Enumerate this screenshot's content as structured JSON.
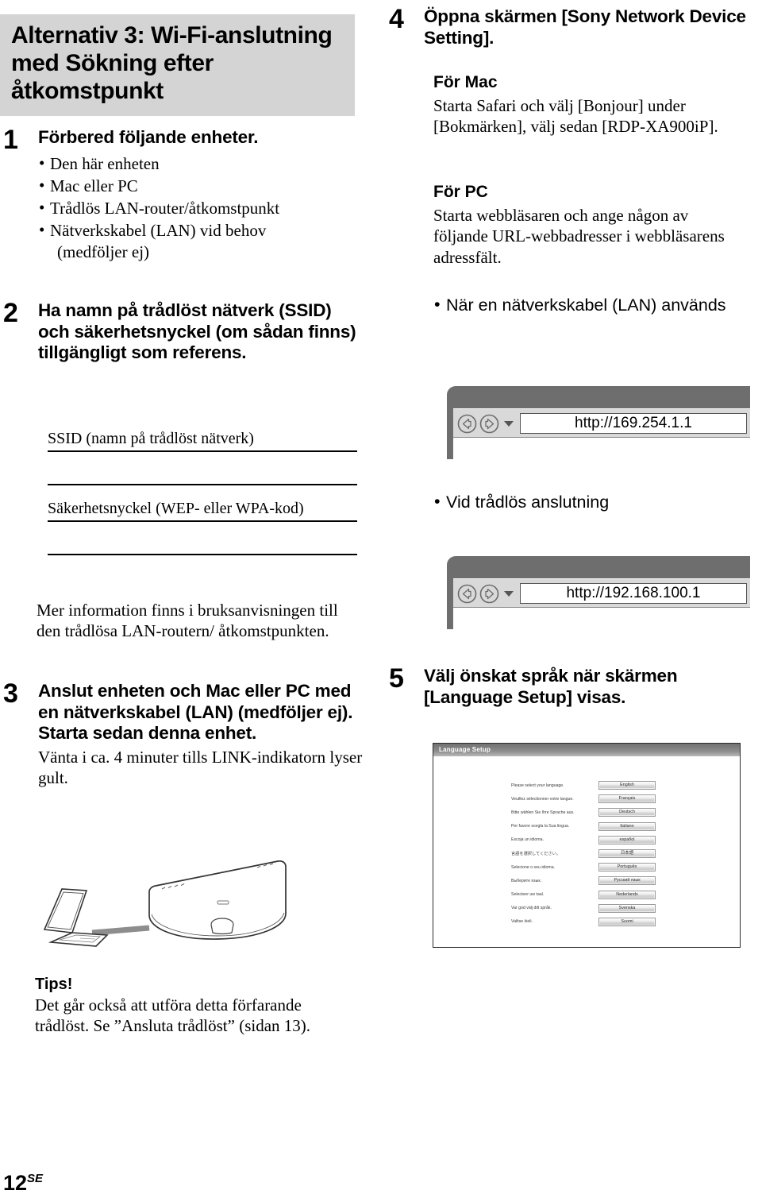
{
  "heading": {
    "text": "Alternativ 3: Wi-Fi-anslutning med Sökning efter åtkomstpunkt"
  },
  "steps": {
    "one": {
      "number": "1",
      "title": "Förbered följande enheter.",
      "bullets": [
        "Den här enheten",
        "Mac eller PC",
        "Trådlös LAN-router/åtkomstpunkt",
        "Nätverkskabel (LAN) vid behov"
      ],
      "bullet_cont": "(medföljer ej)"
    },
    "two": {
      "number": "2",
      "title": "Ha namn på trådlöst nätverk (SSID) och säkerhetsnyckel (om sådan finns) tillgängligt som referens.",
      "field_ssid_label": "SSID (namn på trådlöst nätverk)",
      "field_key_label": "Säkerhetsnyckel (WEP- eller WPA-kod)",
      "note": "Mer information finns i bruksanvisningen till den trådlösa LAN-routern/ åtkomstpunkten."
    },
    "three": {
      "number": "3",
      "title": "Anslut enheten och Mac eller PC med en nätverkskabel (LAN) (medföljer ej). Starta sedan denna enhet.",
      "note": "Vänta i ca. 4 minuter tills LINK-indikatorn lyser gult."
    },
    "four": {
      "number": "4",
      "title": "Öppna skärmen [Sony Network Device Setting].",
      "mac_head": "För Mac",
      "mac_text": "Starta Safari och välj [Bonjour] under [Bokmärken], välj sedan [RDP-XA900iP].",
      "pc_head": "För PC",
      "pc_text": "Starta webbläsaren och ange någon av följande URL-webbadresser i webbläsarens adressfält.",
      "bullet_lan": "När en nätverkskabel (LAN) används",
      "url_lan": "http://169.254.1.1",
      "bullet_wireless": "Vid trådlös anslutning",
      "url_wireless": "http://192.168.100.1"
    },
    "five": {
      "number": "5",
      "title": "Välj önskat språk när skärmen [Language Setup] visas."
    }
  },
  "tips": {
    "title": "Tips!",
    "text": "Det går också att utföra detta förfarande trådlöst. Se ”Ansluta trådlöst” (sidan 13)."
  },
  "language_dialog": {
    "title": "Language Setup",
    "rows": [
      {
        "prompt": "Please select your language.",
        "button": "English"
      },
      {
        "prompt": "Veuillez sélectionner votre langue.",
        "button": "Français"
      },
      {
        "prompt": "Bitte wählen Sie Ihre Sprache aus.",
        "button": "Deutsch"
      },
      {
        "prompt": "Per favore scegla la Sua lingua.",
        "button": "Italiano"
      },
      {
        "prompt": "Escoja un idioma.",
        "button": "español"
      },
      {
        "prompt": "言語を選択してください。",
        "button": "日本語"
      },
      {
        "prompt": "Selecione o seu idioma.",
        "button": "Português"
      },
      {
        "prompt": "Выберите язык.",
        "button": "Русский язык"
      },
      {
        "prompt": "Selecteer uw taal.",
        "button": "Nederlands"
      },
      {
        "prompt": "Var god välj ditt språk.",
        "button": "Svenska"
      },
      {
        "prompt": "Valitse kieli.",
        "button": "Suomi"
      }
    ]
  },
  "footer": {
    "page": "12",
    "suffix": "SE"
  },
  "colors": {
    "heading_band": "#d4d4d4",
    "browser_shell": "#6e6e6e",
    "toolbar": "#d9d9d9"
  }
}
